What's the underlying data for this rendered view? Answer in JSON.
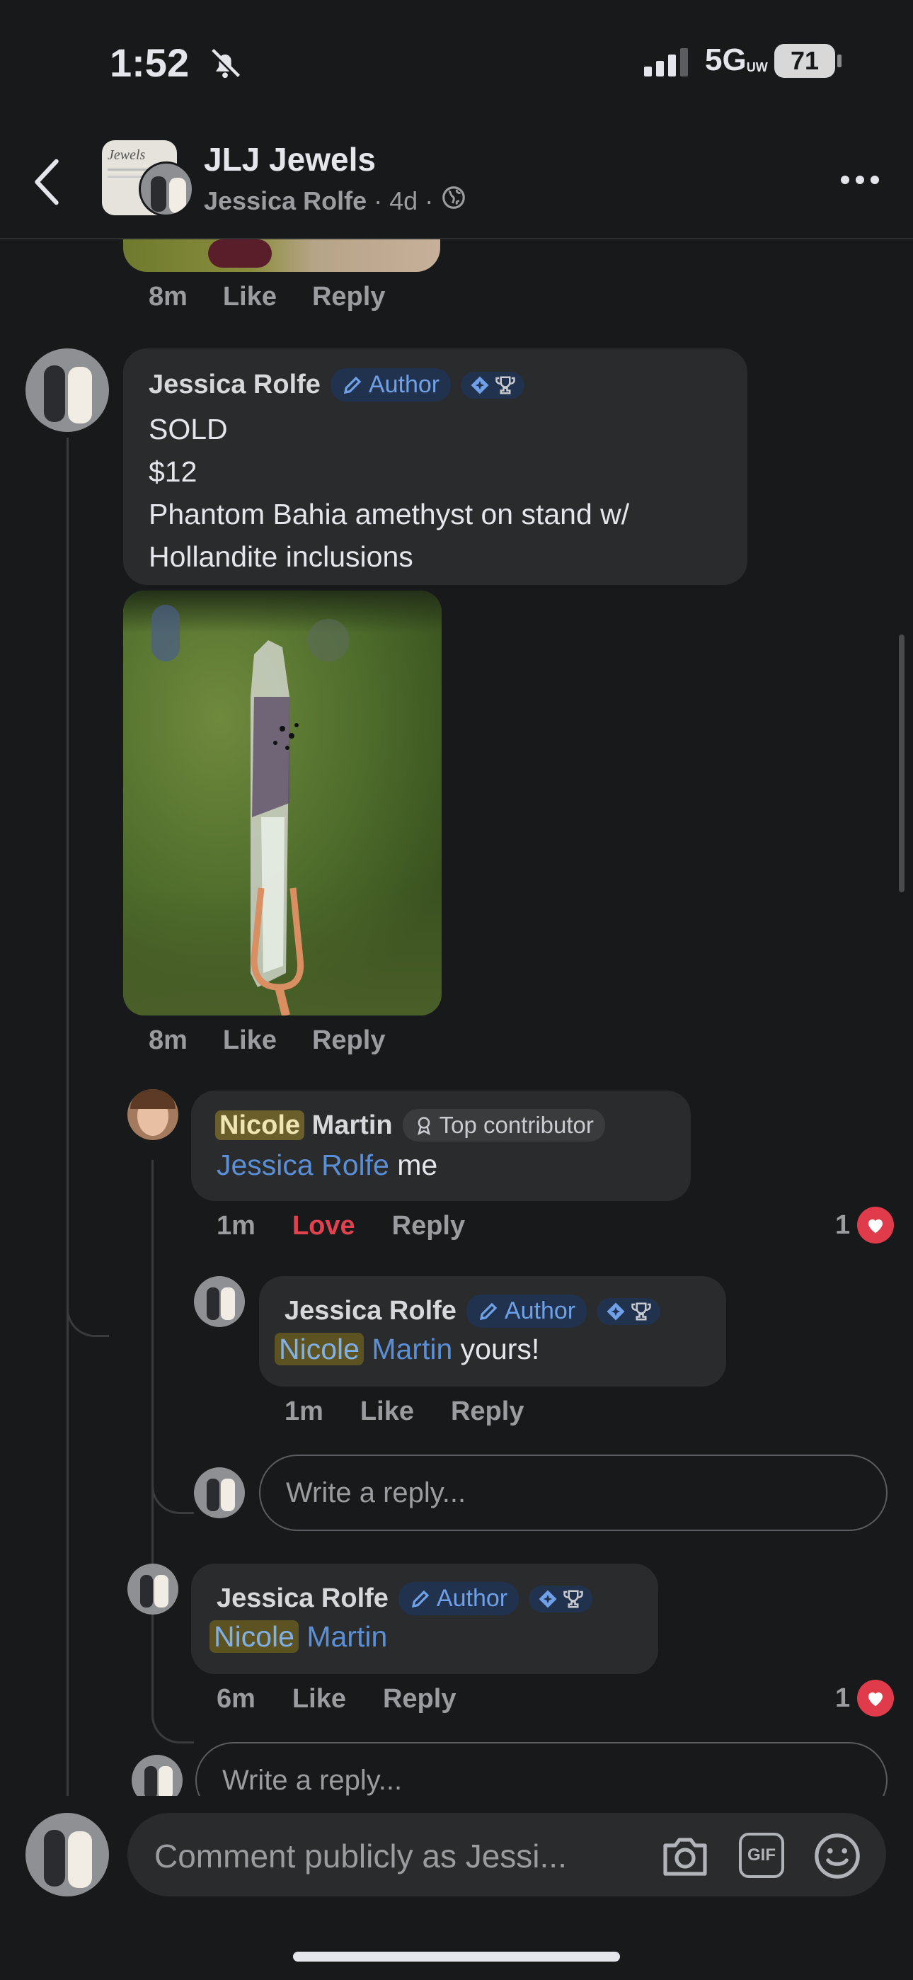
{
  "status_bar": {
    "time": "1:52",
    "network": "5G",
    "network_sub": "UW",
    "battery": "71"
  },
  "header": {
    "group_name": "JLJ Jewels",
    "author": "Jessica Rolfe",
    "time_ago": "4d"
  },
  "top_actions": {
    "time": "8m",
    "like": "Like",
    "reply": "Reply"
  },
  "post": {
    "author": "Jessica Rolfe",
    "author_badge": "Author",
    "lines": [
      "SOLD",
      "$12",
      "Phantom Bahia amethyst on stand w/",
      "Hollandite inclusions"
    ],
    "time": "8m",
    "like": "Like",
    "reply": "Reply"
  },
  "reply1": {
    "first": "Nicole",
    "last": "Martin",
    "badge": "Top contributor",
    "mention": "Jessica Rolfe",
    "text": "me",
    "time": "1m",
    "reaction_label": "Love",
    "reply": "Reply",
    "reaction_count": "1"
  },
  "reply1_1": {
    "author": "Jessica Rolfe",
    "badge": "Author",
    "mention_first": "Nicole",
    "mention_last": "Martin",
    "text": "yours!",
    "time": "1m",
    "like": "Like",
    "reply": "Reply"
  },
  "reply_input_1": {
    "placeholder": "Write a reply..."
  },
  "reply2": {
    "author": "Jessica Rolfe",
    "badge": "Author",
    "mention_first": "Nicole",
    "mention_last": "Martin",
    "time": "6m",
    "like": "Like",
    "reply": "Reply",
    "reaction_count": "1"
  },
  "reply_input_2": {
    "placeholder": "Write a reply..."
  },
  "composer": {
    "placeholder": "Comment publicly as Jessi...",
    "gif_label": "GIF"
  },
  "colors": {
    "background": "#18191a",
    "bubble": "#2a2b2c",
    "mention": "#5b8fd6",
    "love": "#e03b4a"
  }
}
